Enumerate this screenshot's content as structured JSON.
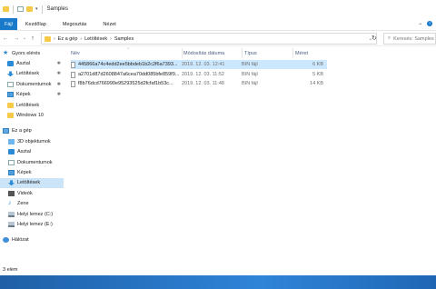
{
  "window": {
    "title": "Samples",
    "help_icon": "help-icon",
    "ribbon_collapse_icon": "chevron-down-icon"
  },
  "ribbon": {
    "tabs": [
      "Fájl",
      "Kezdőlap",
      "Megosztás",
      "Nézet"
    ]
  },
  "address": {
    "crumbs": [
      "Ez a gép",
      "Letöltések",
      "Samples"
    ],
    "search_placeholder": "Keresés: Samples"
  },
  "sidebar": {
    "quick_access": "Gyors elérés",
    "pinned": [
      {
        "label": "Asztal",
        "icon": "blue",
        "pinned": true
      },
      {
        "label": "Letöltések",
        "icon": "dl",
        "pinned": true
      },
      {
        "label": "Dokumentumok",
        "icon": "doc",
        "pinned": true
      },
      {
        "label": "Képek",
        "icon": "img",
        "pinned": true
      },
      {
        "label": "Letöltések",
        "icon": "folder",
        "pinned": false
      },
      {
        "label": "Windows 10",
        "icon": "folder",
        "pinned": false
      }
    ],
    "this_pc": "Ez a gép",
    "pc_items": [
      {
        "label": "3D objektumok",
        "icon": "3d"
      },
      {
        "label": "Asztal",
        "icon": "blue"
      },
      {
        "label": "Dokumentumok",
        "icon": "doc"
      },
      {
        "label": "Képek",
        "icon": "img"
      },
      {
        "label": "Letöltések",
        "icon": "dl",
        "selected": true
      },
      {
        "label": "Videók",
        "icon": "vid"
      },
      {
        "label": "Zene",
        "icon": "music"
      },
      {
        "label": "Helyi lemez (C:)",
        "icon": "drive"
      },
      {
        "label": "Helyi lemez (E:)",
        "icon": "drive"
      }
    ],
    "network": "Hálózat"
  },
  "columns": {
    "name": "Név",
    "date": "Módosítás dátuma",
    "type": "Típus",
    "size": "Méret"
  },
  "files": [
    {
      "name": "445866a74c4edd2ee5bbdeb1b2c2f6a7393...",
      "date": "2019. 12. 03. 12:41",
      "type": "BIN fájl",
      "size": "6 KB",
      "selected": true
    },
    {
      "name": "a2701d87d2608847a6cea70dd085bfe859f9...",
      "date": "2019. 12. 03. 11:52",
      "type": "BIN fájl",
      "size": "5 KB",
      "selected": false
    },
    {
      "name": "f8b76dcd766990e95293525d2fcfaf1b53c...",
      "date": "2019. 12. 03. 11:48",
      "type": "BIN fájl",
      "size": "14 KB",
      "selected": false
    }
  ],
  "status": {
    "item_count": "3 elem"
  },
  "colors": {
    "file_tab": "#1979ca",
    "selection": "#cce4f7",
    "taskbar": "#2f84d9"
  }
}
